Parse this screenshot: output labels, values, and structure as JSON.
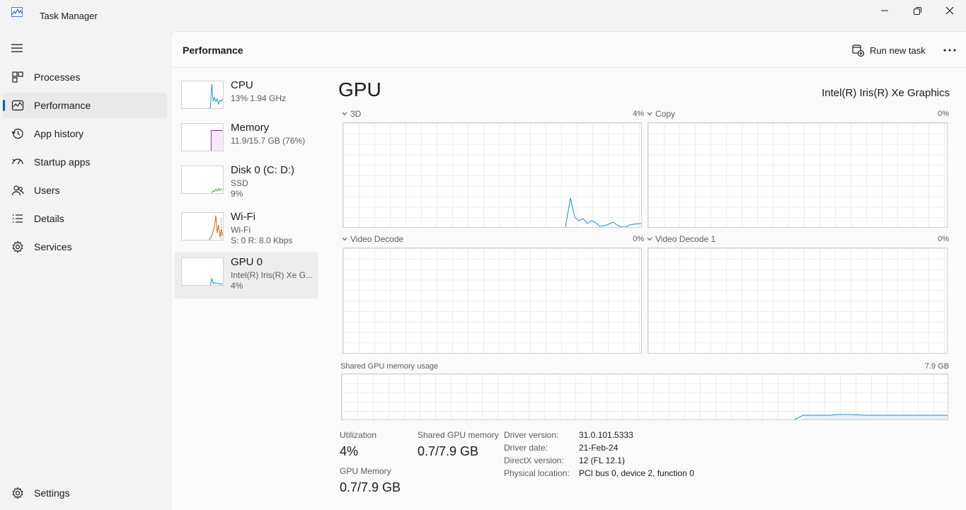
{
  "window": {
    "title": "Task Manager"
  },
  "nav": {
    "items": [
      {
        "label": "Processes",
        "icon": "processes-icon"
      },
      {
        "label": "Performance",
        "icon": "performance-icon",
        "active": true
      },
      {
        "label": "App history",
        "icon": "history-icon"
      },
      {
        "label": "Startup apps",
        "icon": "startup-icon"
      },
      {
        "label": "Users",
        "icon": "users-icon"
      },
      {
        "label": "Details",
        "icon": "details-icon"
      },
      {
        "label": "Services",
        "icon": "services-icon"
      }
    ],
    "settings": "Settings"
  },
  "header": {
    "title": "Performance",
    "run_task": "Run new task"
  },
  "resources": [
    {
      "name": "CPU",
      "line1": "13%  1.94 GHz",
      "line2": ""
    },
    {
      "name": "Memory",
      "line1": "11.9/15.7 GB (76%)",
      "line2": ""
    },
    {
      "name": "Disk 0 (C: D:)",
      "line1": "SSD",
      "line2": "9%"
    },
    {
      "name": "Wi-Fi",
      "line1": "Wi-Fi",
      "line2": "S: 0 R: 8.0 Kbps"
    },
    {
      "name": "GPU 0",
      "line1": "Intel(R) Iris(R) Xe G...",
      "line2": "4%"
    }
  ],
  "gpu": {
    "title": "GPU",
    "model": "Intel(R) Iris(R) Xe Graphics",
    "engines": [
      {
        "label": "3D",
        "pct": "4%"
      },
      {
        "label": "Copy",
        "pct": "0%"
      },
      {
        "label": "Video Decode",
        "pct": "0%"
      },
      {
        "label": "Video Decode 1",
        "pct": "0%"
      }
    ],
    "shared_mem_label": "Shared GPU memory usage",
    "shared_mem_max": "7.9 GB",
    "stats": {
      "utilization_label": "Utilization",
      "utilization": "4%",
      "shared_label": "Shared GPU memory",
      "shared": "0.7/7.9 GB",
      "gpu_mem_label": "GPU Memory",
      "gpu_mem": "0.7/7.9 GB"
    },
    "info": [
      {
        "key": "Driver version:",
        "value": "31.0.101.5333"
      },
      {
        "key": "Driver date:",
        "value": "21-Feb-24"
      },
      {
        "key": "DirectX version:",
        "value": "12 (FL 12.1)"
      },
      {
        "key": "Physical location:",
        "value": "PCI bus 0, device 2, function 0"
      }
    ]
  },
  "colors": {
    "accent": "#005fb8",
    "cpu": "#1a8fd1",
    "memory": "#8b1fa3",
    "disk": "#4ca12c",
    "wifi": "#c9621a",
    "gpu": "#1a8fd1"
  }
}
